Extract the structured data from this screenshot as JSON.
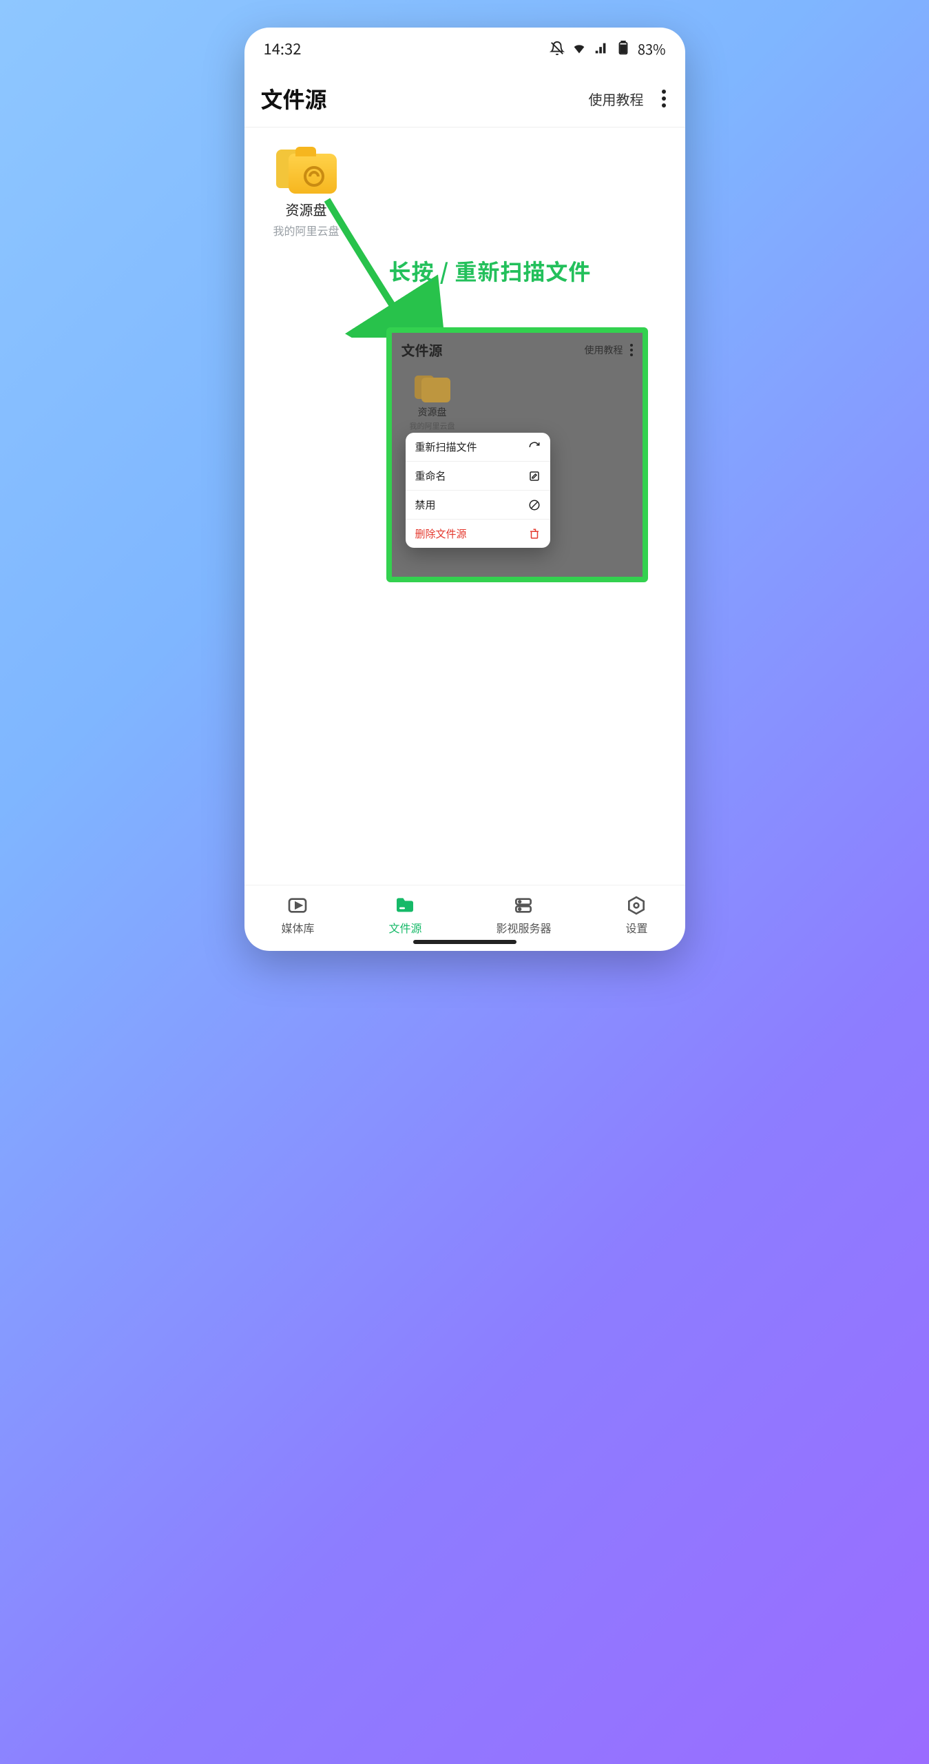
{
  "status": {
    "time": "14:32",
    "battery": "83%"
  },
  "header": {
    "title": "文件源",
    "help": "使用教程"
  },
  "folder": {
    "title": "资源盘",
    "subtitle": "我的阿里云盘"
  },
  "annotation": {
    "label": "长按 / 重新扫描文件"
  },
  "inset": {
    "header_title": "文件源",
    "help": "使用教程",
    "folder_title": "资源盘",
    "folder_subtitle": "我的阿里云盘",
    "menu": {
      "rescan": "重新扫描文件",
      "rename": "重命名",
      "disable": "禁用",
      "delete": "删除文件源"
    }
  },
  "nav": {
    "library": "媒体库",
    "sources": "文件源",
    "servers": "影视服务器",
    "settings": "设置"
  }
}
